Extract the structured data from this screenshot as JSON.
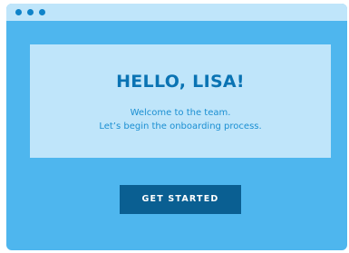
{
  "window": {
    "controls": [
      "window-dot",
      "window-dot",
      "window-dot"
    ]
  },
  "card": {
    "title": "HELLO, LISA!",
    "line1": "Welcome to the team.",
    "line2": "Let’s begin the onboarding process."
  },
  "actions": {
    "get_started_label": "GET STARTED"
  },
  "colors": {
    "background": "#4eb6ee",
    "titlebar": "#bfe5fa",
    "card": "#bfe5fa",
    "title_text": "#0a73b3",
    "body_text": "#1b8fd2",
    "button": "#0a5f92",
    "button_text": "#ffffff",
    "window_dots": "#0f83c9"
  }
}
